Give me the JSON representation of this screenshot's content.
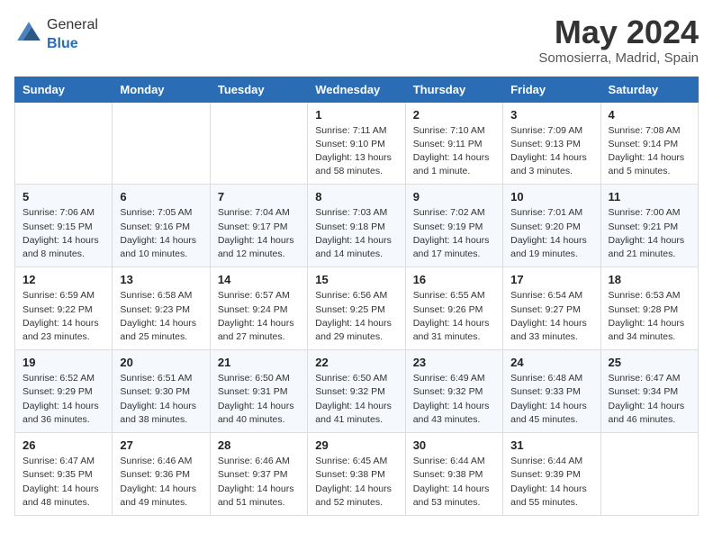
{
  "header": {
    "logo_general": "General",
    "logo_blue": "Blue",
    "month": "May 2024",
    "location": "Somosierra, Madrid, Spain"
  },
  "weekdays": [
    "Sunday",
    "Monday",
    "Tuesday",
    "Wednesday",
    "Thursday",
    "Friday",
    "Saturday"
  ],
  "weeks": [
    [
      {
        "day": "",
        "info": ""
      },
      {
        "day": "",
        "info": ""
      },
      {
        "day": "",
        "info": ""
      },
      {
        "day": "1",
        "info": "Sunrise: 7:11 AM\nSunset: 9:10 PM\nDaylight: 13 hours\nand 58 minutes."
      },
      {
        "day": "2",
        "info": "Sunrise: 7:10 AM\nSunset: 9:11 PM\nDaylight: 14 hours\nand 1 minute."
      },
      {
        "day": "3",
        "info": "Sunrise: 7:09 AM\nSunset: 9:13 PM\nDaylight: 14 hours\nand 3 minutes."
      },
      {
        "day": "4",
        "info": "Sunrise: 7:08 AM\nSunset: 9:14 PM\nDaylight: 14 hours\nand 5 minutes."
      }
    ],
    [
      {
        "day": "5",
        "info": "Sunrise: 7:06 AM\nSunset: 9:15 PM\nDaylight: 14 hours\nand 8 minutes."
      },
      {
        "day": "6",
        "info": "Sunrise: 7:05 AM\nSunset: 9:16 PM\nDaylight: 14 hours\nand 10 minutes."
      },
      {
        "day": "7",
        "info": "Sunrise: 7:04 AM\nSunset: 9:17 PM\nDaylight: 14 hours\nand 12 minutes."
      },
      {
        "day": "8",
        "info": "Sunrise: 7:03 AM\nSunset: 9:18 PM\nDaylight: 14 hours\nand 14 minutes."
      },
      {
        "day": "9",
        "info": "Sunrise: 7:02 AM\nSunset: 9:19 PM\nDaylight: 14 hours\nand 17 minutes."
      },
      {
        "day": "10",
        "info": "Sunrise: 7:01 AM\nSunset: 9:20 PM\nDaylight: 14 hours\nand 19 minutes."
      },
      {
        "day": "11",
        "info": "Sunrise: 7:00 AM\nSunset: 9:21 PM\nDaylight: 14 hours\nand 21 minutes."
      }
    ],
    [
      {
        "day": "12",
        "info": "Sunrise: 6:59 AM\nSunset: 9:22 PM\nDaylight: 14 hours\nand 23 minutes."
      },
      {
        "day": "13",
        "info": "Sunrise: 6:58 AM\nSunset: 9:23 PM\nDaylight: 14 hours\nand 25 minutes."
      },
      {
        "day": "14",
        "info": "Sunrise: 6:57 AM\nSunset: 9:24 PM\nDaylight: 14 hours\nand 27 minutes."
      },
      {
        "day": "15",
        "info": "Sunrise: 6:56 AM\nSunset: 9:25 PM\nDaylight: 14 hours\nand 29 minutes."
      },
      {
        "day": "16",
        "info": "Sunrise: 6:55 AM\nSunset: 9:26 PM\nDaylight: 14 hours\nand 31 minutes."
      },
      {
        "day": "17",
        "info": "Sunrise: 6:54 AM\nSunset: 9:27 PM\nDaylight: 14 hours\nand 33 minutes."
      },
      {
        "day": "18",
        "info": "Sunrise: 6:53 AM\nSunset: 9:28 PM\nDaylight: 14 hours\nand 34 minutes."
      }
    ],
    [
      {
        "day": "19",
        "info": "Sunrise: 6:52 AM\nSunset: 9:29 PM\nDaylight: 14 hours\nand 36 minutes."
      },
      {
        "day": "20",
        "info": "Sunrise: 6:51 AM\nSunset: 9:30 PM\nDaylight: 14 hours\nand 38 minutes."
      },
      {
        "day": "21",
        "info": "Sunrise: 6:50 AM\nSunset: 9:31 PM\nDaylight: 14 hours\nand 40 minutes."
      },
      {
        "day": "22",
        "info": "Sunrise: 6:50 AM\nSunset: 9:32 PM\nDaylight: 14 hours\nand 41 minutes."
      },
      {
        "day": "23",
        "info": "Sunrise: 6:49 AM\nSunset: 9:32 PM\nDaylight: 14 hours\nand 43 minutes."
      },
      {
        "day": "24",
        "info": "Sunrise: 6:48 AM\nSunset: 9:33 PM\nDaylight: 14 hours\nand 45 minutes."
      },
      {
        "day": "25",
        "info": "Sunrise: 6:47 AM\nSunset: 9:34 PM\nDaylight: 14 hours\nand 46 minutes."
      }
    ],
    [
      {
        "day": "26",
        "info": "Sunrise: 6:47 AM\nSunset: 9:35 PM\nDaylight: 14 hours\nand 48 minutes."
      },
      {
        "day": "27",
        "info": "Sunrise: 6:46 AM\nSunset: 9:36 PM\nDaylight: 14 hours\nand 49 minutes."
      },
      {
        "day": "28",
        "info": "Sunrise: 6:46 AM\nSunset: 9:37 PM\nDaylight: 14 hours\nand 51 minutes."
      },
      {
        "day": "29",
        "info": "Sunrise: 6:45 AM\nSunset: 9:38 PM\nDaylight: 14 hours\nand 52 minutes."
      },
      {
        "day": "30",
        "info": "Sunrise: 6:44 AM\nSunset: 9:38 PM\nDaylight: 14 hours\nand 53 minutes."
      },
      {
        "day": "31",
        "info": "Sunrise: 6:44 AM\nSunset: 9:39 PM\nDaylight: 14 hours\nand 55 minutes."
      },
      {
        "day": "",
        "info": ""
      }
    ]
  ]
}
